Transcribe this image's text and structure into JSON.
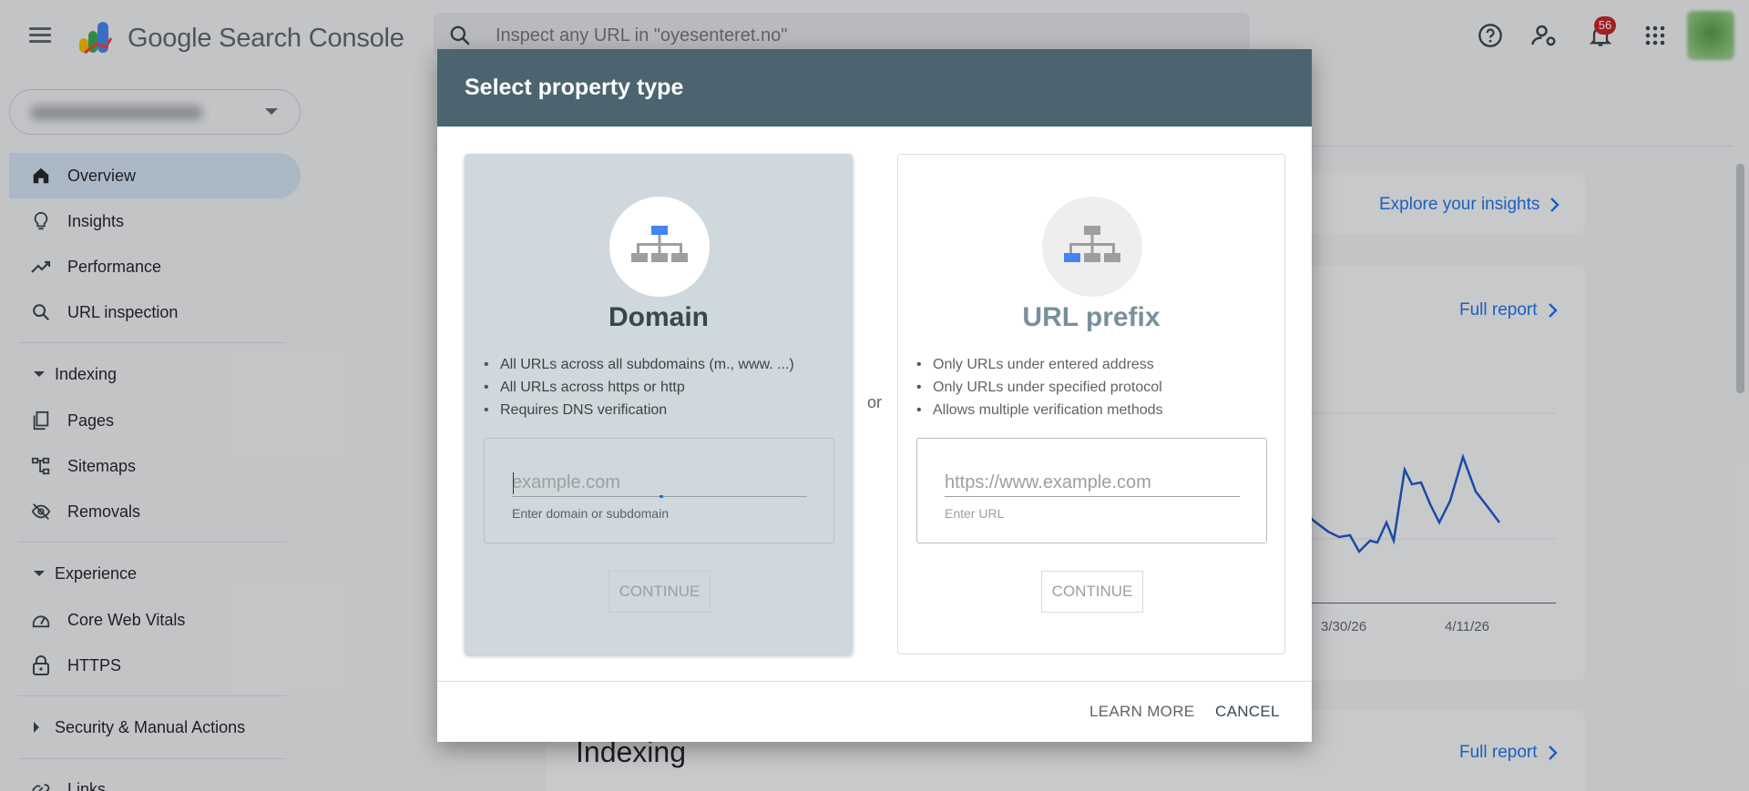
{
  "app": {
    "name": "Google Search Console",
    "search_placeholder": "Inspect any URL in \"oyesenteret.no\"",
    "notification_count": "56"
  },
  "sidebar": {
    "items": [
      {
        "label": "Overview",
        "icon": "home-icon"
      },
      {
        "label": "Insights",
        "icon": "lightbulb-icon"
      },
      {
        "label": "Performance",
        "icon": "trending-up-icon"
      },
      {
        "label": "URL inspection",
        "icon": "search-icon"
      }
    ],
    "indexing": {
      "label": "Indexing",
      "items": [
        {
          "label": "Pages",
          "icon": "pages-icon"
        },
        {
          "label": "Sitemaps",
          "icon": "sitemap-icon"
        },
        {
          "label": "Removals",
          "icon": "eye-off-icon"
        }
      ]
    },
    "experience": {
      "label": "Experience",
      "items": [
        {
          "label": "Core Web Vitals",
          "icon": "speedometer-icon"
        },
        {
          "label": "HTTPS",
          "icon": "lock-icon"
        }
      ]
    },
    "security": {
      "label": "Security & Manual Actions"
    },
    "links": {
      "label": "Links"
    }
  },
  "background": {
    "explore_insights": "Explore your insights",
    "full_report": "Full report",
    "chart_ticks": [
      "3/30/26",
      "4/11/26"
    ],
    "indexing_heading": "Indexing"
  },
  "dialog": {
    "title": "Select property type",
    "or": "or",
    "learn_more": "LEARN MORE",
    "cancel": "CANCEL",
    "domain": {
      "title": "Domain",
      "bullets": [
        "All URLs across all subdomains (m., www. ...)",
        "All URLs across https or http",
        "Requires DNS verification"
      ],
      "placeholder": "example.com",
      "helper": "Enter domain or subdomain",
      "continue": "CONTINUE"
    },
    "url_prefix": {
      "title": "URL prefix",
      "bullets": [
        "Only URLs under entered address",
        "Only URLs under specified protocol",
        "Allows multiple verification methods"
      ],
      "placeholder": "https://www.example.com",
      "helper": "Enter URL",
      "continue": "CONTINUE"
    }
  },
  "colors": {
    "dialog_header": "#4b6470",
    "domain_card_bg": "#cfd8dc",
    "link_blue": "#1a73e8",
    "active_nav_bg": "#d3e3f2"
  }
}
